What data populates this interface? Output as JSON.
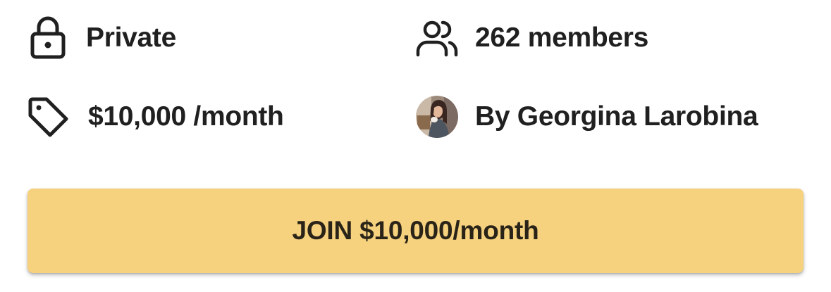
{
  "group_info": {
    "privacy": {
      "label": "Private",
      "icon": "lock-icon"
    },
    "members": {
      "label": "262 members",
      "icon": "users-icon"
    },
    "price": {
      "label": "$10,000 /month",
      "icon": "tag-icon"
    },
    "owner": {
      "label": "By Georgina Larobina",
      "icon": "avatar"
    }
  },
  "join_button": {
    "label": "JOIN $10,000/month",
    "color": "#f6d27f"
  },
  "colors": {
    "text": "#202020",
    "accent": "#f6d27f"
  }
}
